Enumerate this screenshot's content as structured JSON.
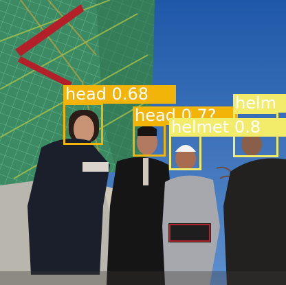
{
  "colors": {
    "sky": "#2f67b8",
    "scaffold_net": "#3f8f66",
    "head_box": "#f2b409",
    "helmet_box": "#f2ec6a"
  },
  "detections": [
    {
      "label": "head 0.68",
      "class": "head"
    },
    {
      "label": "head 0.7?",
      "class": "head"
    },
    {
      "label": "helmet 0.8",
      "class": "helmet"
    },
    {
      "label": "helm",
      "class": "helmet"
    }
  ]
}
